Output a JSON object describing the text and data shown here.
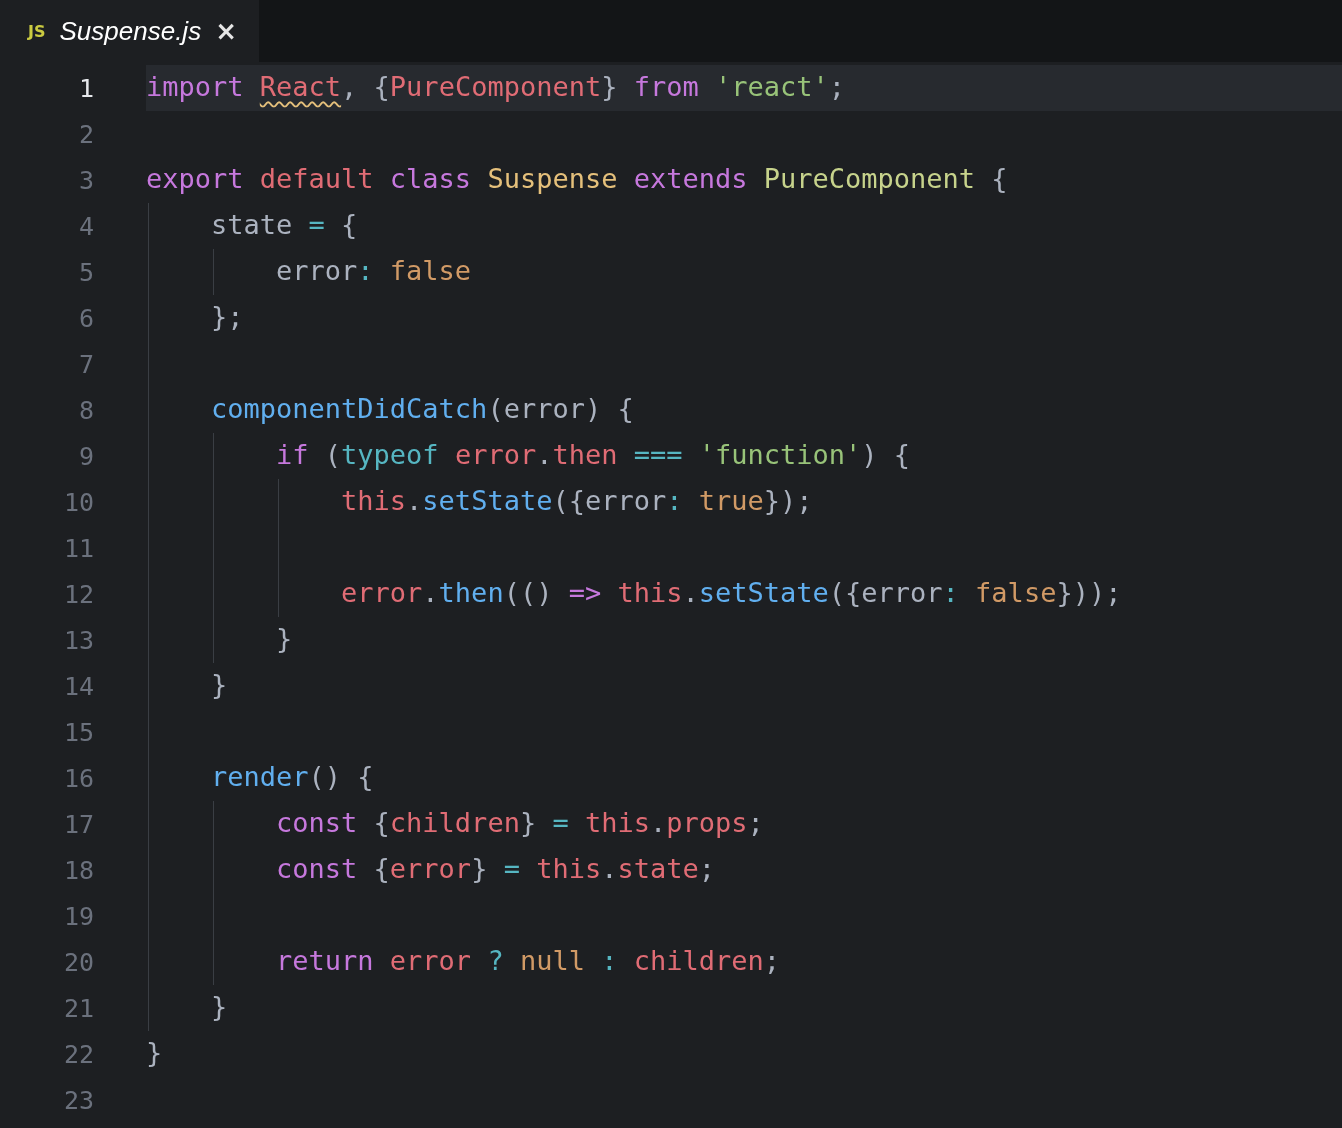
{
  "tab": {
    "icon_label": "JS",
    "title": "Suspense.js",
    "close": "×",
    "selected": true
  },
  "lines": [
    {
      "number": "1",
      "current": true,
      "tokens": [
        {
          "kind": "keyword",
          "text": "import "
        },
        {
          "kind": "variable",
          "text": "React",
          "warning": true
        },
        {
          "kind": "plain",
          "text": ", {"
        },
        {
          "kind": "variable",
          "text": "PureComponent"
        },
        {
          "kind": "plain",
          "text": "} "
        },
        {
          "kind": "keyword",
          "text": "from "
        },
        {
          "kind": "string",
          "text": "'react'"
        },
        {
          "kind": "plain",
          "text": ";"
        }
      ]
    },
    {
      "number": "2",
      "current": false
    },
    {
      "number": "3",
      "current": false,
      "tokens": [
        {
          "kind": "keyword",
          "text": "export "
        },
        {
          "kind": "variable",
          "text": "default "
        },
        {
          "kind": "keyword",
          "text": "class "
        },
        {
          "kind": "class",
          "text": "Suspense "
        },
        {
          "kind": "keyword",
          "text": "extends "
        },
        {
          "kind": "inherited",
          "text": "PureComponent "
        },
        {
          "kind": "plain",
          "text": "{"
        }
      ]
    },
    {
      "number": "4",
      "current": false,
      "tokens": [
        {
          "kind": "plain",
          "text": "    state "
        },
        {
          "kind": "operator",
          "text": "= "
        },
        {
          "kind": "plain",
          "text": "{"
        }
      ]
    },
    {
      "number": "5",
      "current": false,
      "tokens": [
        {
          "kind": "plain",
          "text": "        error"
        },
        {
          "kind": "operator",
          "text": ": "
        },
        {
          "kind": "literal",
          "text": "false"
        }
      ]
    },
    {
      "number": "6",
      "current": false,
      "tokens": [
        {
          "kind": "plain",
          "text": "    };"
        }
      ]
    },
    {
      "number": "7",
      "current": false
    },
    {
      "number": "8",
      "current": false,
      "tokens": [
        {
          "kind": "function",
          "text": "    componentDidCatch"
        },
        {
          "kind": "plain",
          "text": "(error) {"
        }
      ]
    },
    {
      "number": "9",
      "current": false,
      "tokens": [
        {
          "kind": "keyword",
          "text": "        if "
        },
        {
          "kind": "plain",
          "text": "("
        },
        {
          "kind": "operator",
          "text": "typeof "
        },
        {
          "kind": "variable",
          "text": "error"
        },
        {
          "kind": "plain",
          "text": "."
        },
        {
          "kind": "variable",
          "text": "then "
        },
        {
          "kind": "operator",
          "text": "=== "
        },
        {
          "kind": "string",
          "text": "'function'"
        },
        {
          "kind": "plain",
          "text": ") {"
        }
      ]
    },
    {
      "number": "10",
      "current": false,
      "tokens": [
        {
          "kind": "variable",
          "text": "            this"
        },
        {
          "kind": "plain",
          "text": "."
        },
        {
          "kind": "function",
          "text": "setState"
        },
        {
          "kind": "plain",
          "text": "({error"
        },
        {
          "kind": "operator",
          "text": ": "
        },
        {
          "kind": "literal",
          "text": "true"
        },
        {
          "kind": "plain",
          "text": "});"
        }
      ]
    },
    {
      "number": "11",
      "current": false
    },
    {
      "number": "12",
      "current": false,
      "tokens": [
        {
          "kind": "variable",
          "text": "            error"
        },
        {
          "kind": "plain",
          "text": "."
        },
        {
          "kind": "function",
          "text": "then"
        },
        {
          "kind": "plain",
          "text": "(() "
        },
        {
          "kind": "keyword",
          "text": "=> "
        },
        {
          "kind": "variable",
          "text": "this"
        },
        {
          "kind": "plain",
          "text": "."
        },
        {
          "kind": "function",
          "text": "setState"
        },
        {
          "kind": "plain",
          "text": "({error"
        },
        {
          "kind": "operator",
          "text": ": "
        },
        {
          "kind": "literal",
          "text": "false"
        },
        {
          "kind": "plain",
          "text": "}));"
        }
      ]
    },
    {
      "number": "13",
      "current": false,
      "tokens": [
        {
          "kind": "plain",
          "text": "        }"
        }
      ]
    },
    {
      "number": "14",
      "current": false,
      "tokens": [
        {
          "kind": "plain",
          "text": "    }"
        }
      ]
    },
    {
      "number": "15",
      "current": false
    },
    {
      "number": "16",
      "current": false,
      "tokens": [
        {
          "kind": "function",
          "text": "    render"
        },
        {
          "kind": "plain",
          "text": "() {"
        }
      ]
    },
    {
      "number": "17",
      "current": false,
      "tokens": [
        {
          "kind": "keyword",
          "text": "        const "
        },
        {
          "kind": "plain",
          "text": "{"
        },
        {
          "kind": "variable",
          "text": "children"
        },
        {
          "kind": "plain",
          "text": "} "
        },
        {
          "kind": "operator",
          "text": "= "
        },
        {
          "kind": "variable",
          "text": "this"
        },
        {
          "kind": "plain",
          "text": "."
        },
        {
          "kind": "variable",
          "text": "props"
        },
        {
          "kind": "plain",
          "text": ";"
        }
      ]
    },
    {
      "number": "18",
      "current": false,
      "tokens": [
        {
          "kind": "keyword",
          "text": "        const "
        },
        {
          "kind": "plain",
          "text": "{"
        },
        {
          "kind": "variable",
          "text": "error"
        },
        {
          "kind": "plain",
          "text": "} "
        },
        {
          "kind": "operator",
          "text": "= "
        },
        {
          "kind": "variable",
          "text": "this"
        },
        {
          "kind": "plain",
          "text": "."
        },
        {
          "kind": "variable",
          "text": "state"
        },
        {
          "kind": "plain",
          "text": ";"
        }
      ]
    },
    {
      "number": "19",
      "current": false
    },
    {
      "number": "20",
      "current": false,
      "tokens": [
        {
          "kind": "keyword",
          "text": "        return "
        },
        {
          "kind": "variable",
          "text": "error "
        },
        {
          "kind": "operator",
          "text": "? "
        },
        {
          "kind": "literal",
          "text": "null "
        },
        {
          "kind": "operator",
          "text": ": "
        },
        {
          "kind": "variable",
          "text": "children"
        },
        {
          "kind": "plain",
          "text": ";"
        }
      ]
    },
    {
      "number": "21",
      "current": false,
      "tokens": [
        {
          "kind": "plain",
          "text": "    }"
        }
      ]
    },
    {
      "number": "22",
      "current": false,
      "tokens": [
        {
          "kind": "plain",
          "text": "}"
        }
      ]
    },
    {
      "number": "23",
      "current": false
    }
  ]
}
